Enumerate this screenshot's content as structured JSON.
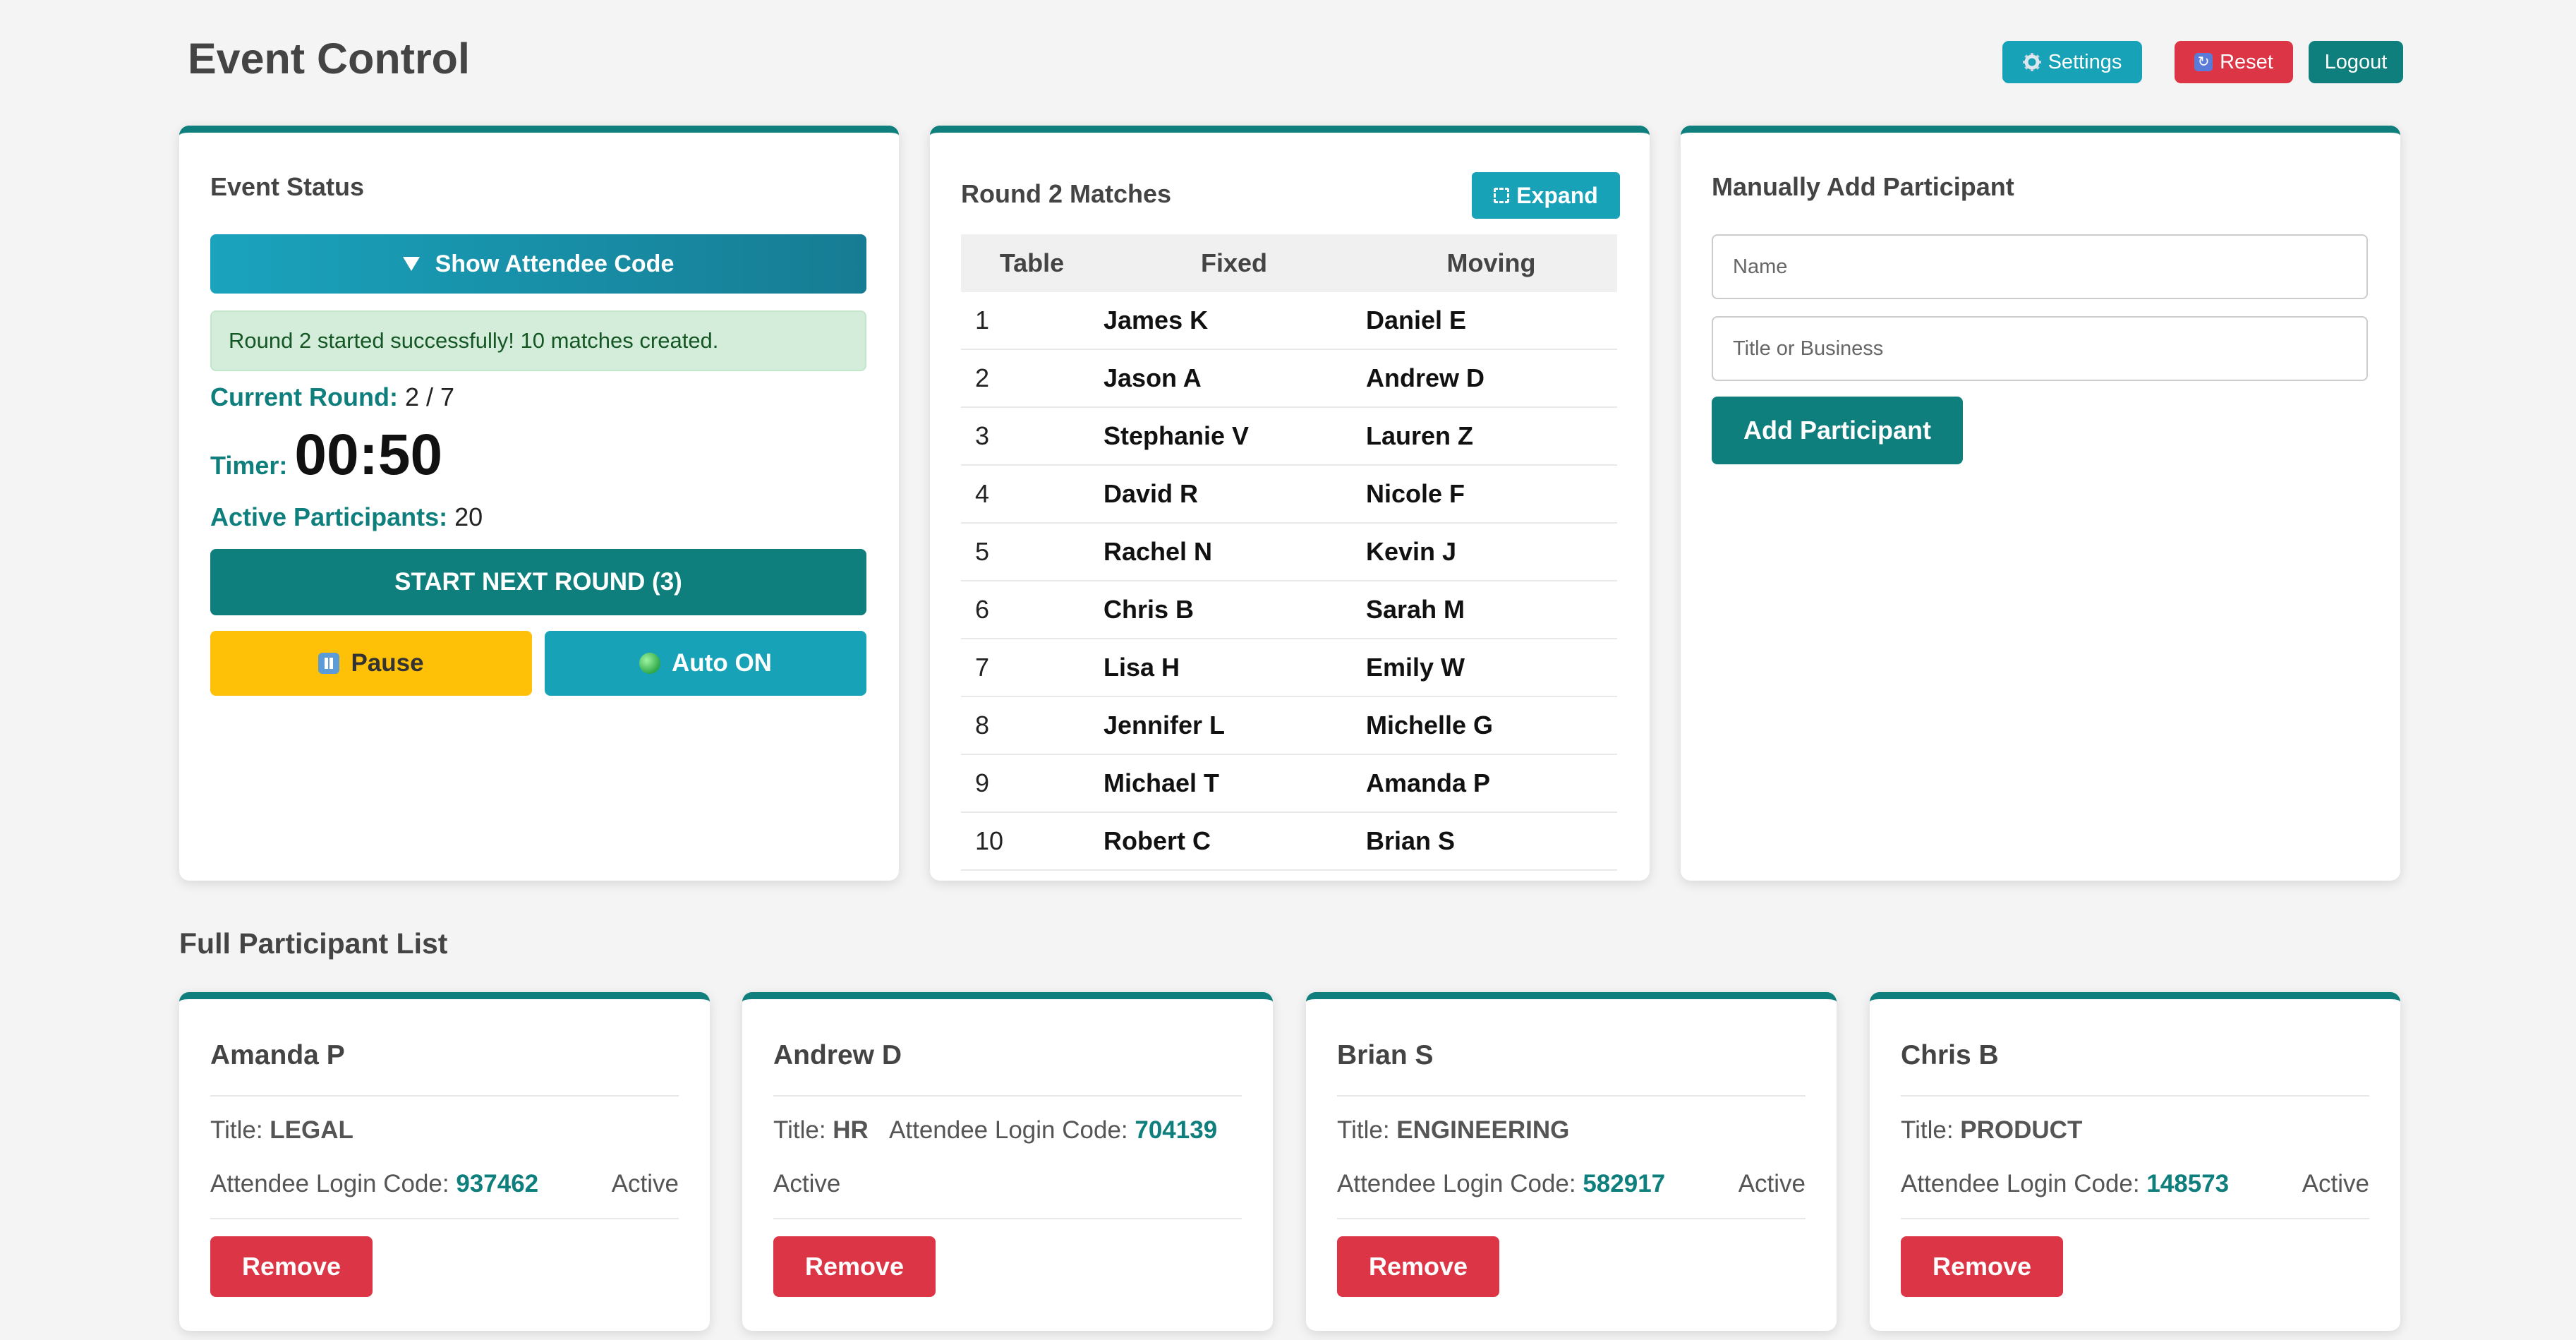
{
  "header": {
    "title": "Event Control",
    "settings_label": "Settings",
    "settings_icon": "gear-icon",
    "reset_label": "Reset",
    "reset_icon": "reset-icon",
    "logout_label": "Logout"
  },
  "status_card": {
    "title": "Event Status",
    "show_code_label": "Show Attendee Code",
    "success_message": "Round 2 started successfully! 10 matches created.",
    "current_round_label": "Current Round:",
    "current_round_value": "2 / 7",
    "timer_label": "Timer:",
    "timer_value": "00:50",
    "active_label": "Active Participants:",
    "active_value": "20",
    "start_label": "START NEXT ROUND (3)",
    "pause_label": "Pause",
    "auto_label": "Auto ON"
  },
  "matches_card": {
    "title": "Round 2 Matches",
    "expand_label": "Expand",
    "columns": [
      "Table",
      "Fixed",
      "Moving"
    ],
    "rows": [
      [
        "1",
        "James K",
        "Daniel E"
      ],
      [
        "2",
        "Jason A",
        "Andrew D"
      ],
      [
        "3",
        "Stephanie V",
        "Lauren Z"
      ],
      [
        "4",
        "David R",
        "Nicole F"
      ],
      [
        "5",
        "Rachel N",
        "Kevin J"
      ],
      [
        "6",
        "Chris B",
        "Sarah M"
      ],
      [
        "7",
        "Lisa H",
        "Emily W"
      ],
      [
        "8",
        "Jennifer L",
        "Michelle G"
      ],
      [
        "9",
        "Michael T",
        "Amanda P"
      ],
      [
        "10",
        "Robert C",
        "Brian S"
      ]
    ]
  },
  "add_card": {
    "title": "Manually Add Participant",
    "name_placeholder": "Name",
    "title_placeholder": "Title or Business",
    "name_value": "",
    "title_value": "",
    "add_label": "Add Participant"
  },
  "participants_section": {
    "title": "Full Participant List",
    "title_prefix": "Title:",
    "code_prefix": "Attendee Login Code:",
    "remove_label": "Remove",
    "items": [
      {
        "name": "Amanda P",
        "title": "LEGAL",
        "code": "937462",
        "status": "Active"
      },
      {
        "name": "Andrew D",
        "title": "HR",
        "code": "704139",
        "status": "Active"
      },
      {
        "name": "Brian S",
        "title": "ENGINEERING",
        "code": "582917",
        "status": "Active"
      },
      {
        "name": "Chris B",
        "title": "PRODUCT",
        "code": "148573",
        "status": "Active"
      }
    ]
  },
  "colors": {
    "primary": "#0f7f7d",
    "info": "#17a2b8",
    "danger": "#dc3545",
    "warning": "#ffc107",
    "success_bg": "#d4edda"
  }
}
